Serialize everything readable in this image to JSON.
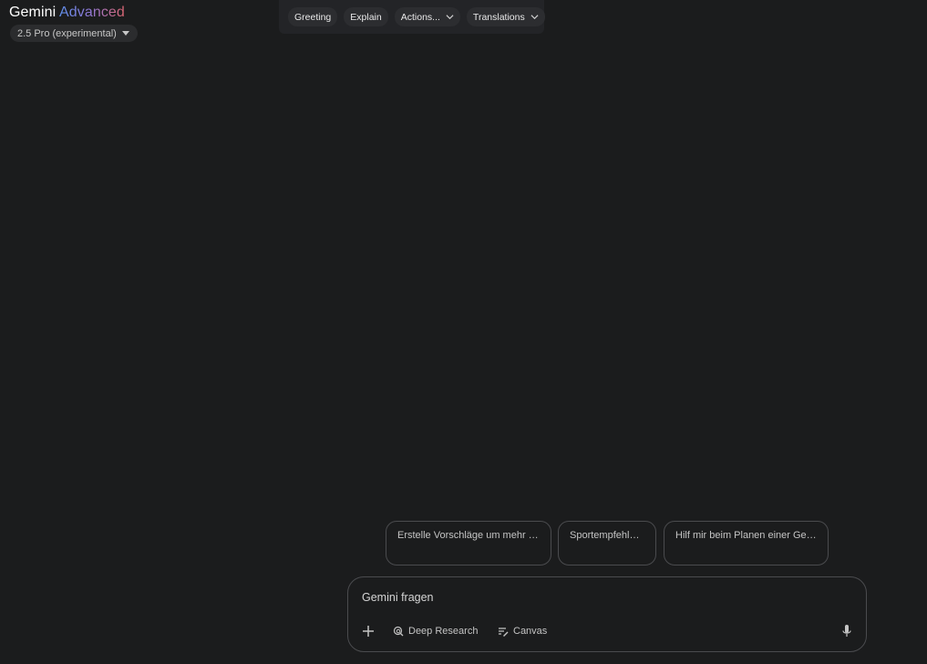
{
  "brand": {
    "name": "Gemini",
    "tier": "Advanced"
  },
  "model_selector": {
    "label": "2.5 Pro (experimental)",
    "icon": "caret-down-icon"
  },
  "toolbar": {
    "greeting": "Greeting",
    "explain": "Explain",
    "actions": "Actions...",
    "translations": "Translations"
  },
  "suggestions": [
    {
      "label": "Erstelle Vorschläge um mehr O..."
    },
    {
      "label": "Sportempfehlung"
    },
    {
      "label": "Hilf mir beim Planen einer Geb..."
    }
  ],
  "composer": {
    "placeholder": "Gemini fragen",
    "deep_research": "Deep Research",
    "canvas": "Canvas",
    "icons": [
      "plus-icon",
      "deep-research-icon",
      "canvas-icon",
      "microphone-icon"
    ]
  },
  "colors": {
    "background": "#1b1c1d",
    "pill": "#2b2c2e",
    "border": "#4a4b4e",
    "advanced_gradient": [
      "#5f8eea",
      "#8d78d6",
      "#d96570"
    ]
  }
}
